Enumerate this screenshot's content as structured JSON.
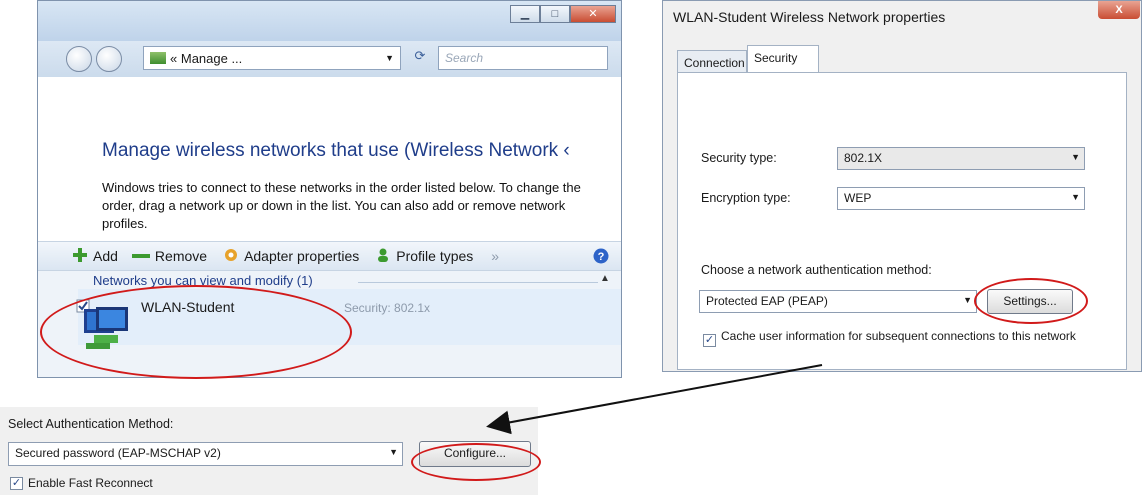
{
  "manage_window": {
    "breadcrumb_chevron": "«",
    "breadcrumb": "Manage ...",
    "search_placeholder": "Search",
    "heading": "Manage wireless networks that use (Wireless Network ‹",
    "description": "Windows tries to connect to these networks in the order listed below. To change the order, drag a network up or down in the list. You can also add or remove network profiles.",
    "toolbar": {
      "add": "Add",
      "remove": "Remove",
      "adapter_properties": "Adapter properties",
      "profile_types": "Profile types",
      "more": "»"
    },
    "group_header": "Networks you can view and modify (1)",
    "network": {
      "name": "WLAN-Student",
      "security": "Security: 802.1x"
    }
  },
  "properties_dialog": {
    "title": "WLAN-Student Wireless Network properties",
    "close_label": "X",
    "tabs": [
      "Connection",
      "Security"
    ],
    "active_tab": "Security",
    "security_type_label": "Security type:",
    "security_type_value": "802.1X",
    "encryption_type_label": "Encryption type:",
    "encryption_type_value": "WEP",
    "auth_method_label": "Choose a network authentication method:",
    "auth_method_value": "Protected EAP (PEAP)",
    "settings_button": "Settings...",
    "cache_checkbox": "Cache user information for subsequent connections to this network",
    "cache_checked": true
  },
  "eap_panel": {
    "select_label": "Select Authentication Method:",
    "method_value": "Secured password (EAP-MSCHAP v2)",
    "configure_button": "Configure...",
    "fast_reconnect_label": "Enable Fast Reconnect",
    "fast_reconnect_checked": true
  },
  "colors": {
    "annotation_red": "#d11a1a",
    "link_blue": "#1f3d8a"
  },
  "icons": [
    "back-icon",
    "forward-icon",
    "network-folder-icon",
    "refresh-icon",
    "add-icon",
    "remove-icon",
    "adapter-icon",
    "profile-types-icon",
    "help-icon",
    "wireless-network-icon",
    "checkmark-icon",
    "dropdown-arrow-icon"
  ]
}
